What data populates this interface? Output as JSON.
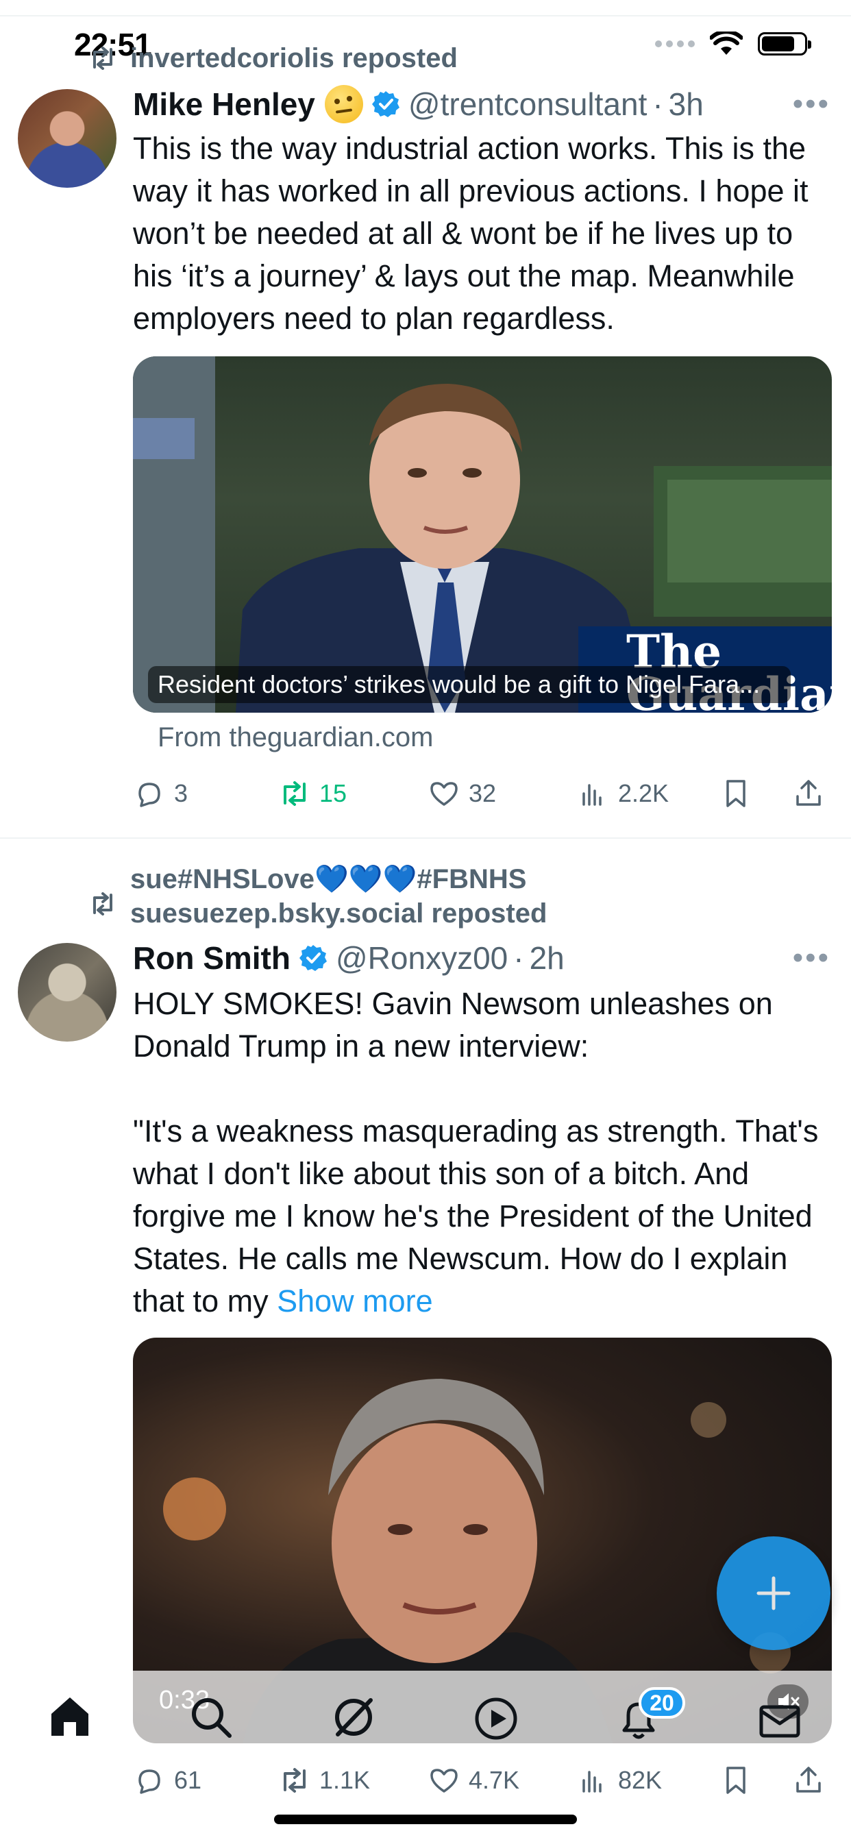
{
  "status_bar": {
    "time": "22:51"
  },
  "feed": {
    "posts": [
      {
        "reposted_by": "invertedcoriolis reposted",
        "name": "Mike Henley",
        "handle": "@trentconsultant",
        "time": "3h",
        "text": "This is the way industrial action works. This is the way it has worked in all previous actions. I hope it won’t be needed at all & wont be if he lives up to his ‘it’s a journey’ & lays out the map. Meanwhile employers need to plan regardless.",
        "card_caption": "Resident doctors’ strikes would be a gift to Nigel Fara...",
        "card_logo": "The Guardian",
        "source": "From theguardian.com",
        "stats": {
          "replies": "3",
          "reposts": "15",
          "likes": "32",
          "views": "2.2K"
        }
      },
      {
        "reposted_by_line1": "sue#NHSLove💙💙💙#FBNHS",
        "reposted_by_line2": "suesuezep.bsky.social reposted",
        "name": "Ron Smith",
        "handle": "@Ronxyz00",
        "time": "2h",
        "text": "HOLY SMOKES! Gavin Newsom unleashes on Donald Trump in a new interview:\n\n\"It's a weakness masquerading as strength. That's what I don't like about this son of a bitch. And forgive me I know he's the President of the United States. He calls me Newscum. How do I explain that to my ",
        "show_more": "Show more",
        "video_time": "0:33",
        "stats": {
          "replies": "61",
          "reposts": "1.1K",
          "likes": "4.7K",
          "views": "82K"
        }
      }
    ]
  },
  "tab_bar": {
    "notifications_badge": "20"
  },
  "colors": {
    "accent": "#1d9bf0",
    "repost_active": "#00ba7c",
    "muted": "#536471"
  }
}
